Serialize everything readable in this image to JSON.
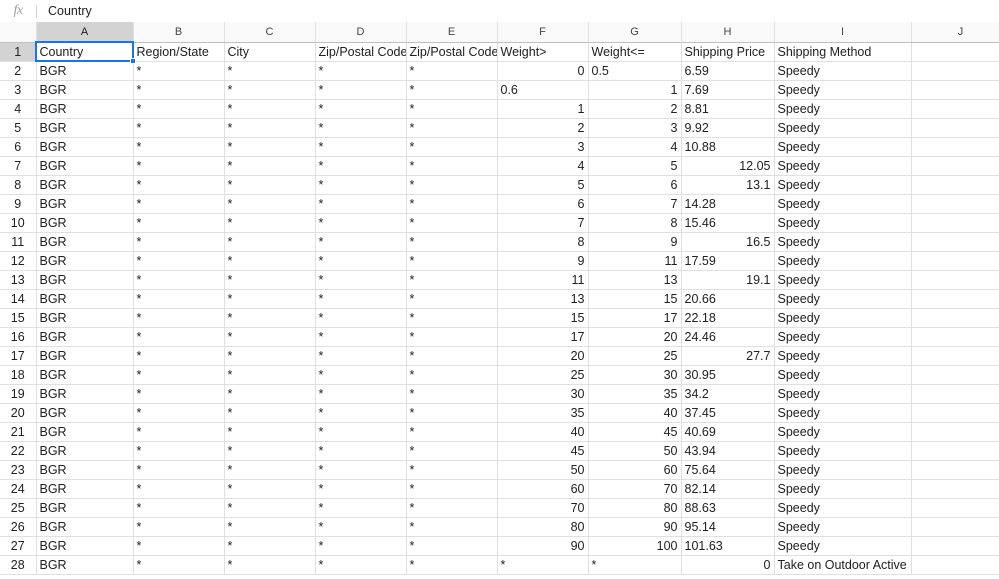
{
  "formula_bar": {
    "fx_label": "fx",
    "value": "Country"
  },
  "selection": {
    "cell": "A1",
    "accent_color": "#1a73e8"
  },
  "grid": {
    "column_letters": [
      "A",
      "B",
      "C",
      "D",
      "E",
      "F",
      "G",
      "H",
      "I",
      "J"
    ],
    "active_column": "A",
    "row_numbers": [
      1,
      2,
      3,
      4,
      5,
      6,
      7,
      8,
      9,
      10,
      11,
      12,
      13,
      14,
      15,
      16,
      17,
      18,
      19,
      20,
      21,
      22,
      23,
      24,
      25,
      26,
      27,
      28
    ],
    "headers": {
      "A": "Country",
      "B": "Region/State",
      "C": "City",
      "D": "Zip/Postal Code",
      "E": "Zip/Postal Code",
      "F": "Weight>",
      "G": "Weight<=",
      "H": "Shipping Price",
      "I": "Shipping Method",
      "J": ""
    },
    "rows": [
      {
        "n": 1,
        "A": "Country",
        "Aa": "left",
        "B": "Region/State",
        "Ba": "left",
        "C": "City",
        "Ca": "left",
        "D": "Zip/Postal Code",
        "Da": "left",
        "E": "Zip/Postal Code",
        "Ea": "left",
        "F": "Weight>",
        "Fa": "left",
        "G": "Weight<=",
        "Ga": "left",
        "H": "Shipping Price",
        "Ha": "left",
        "I": "Shipping Method",
        "Ia": "left",
        "J": ""
      },
      {
        "n": 2,
        "A": "BGR",
        "Aa": "left",
        "B": "*",
        "Ba": "left",
        "C": "*",
        "Ca": "left",
        "D": "*",
        "Da": "left",
        "E": "*",
        "Ea": "left",
        "F": "0",
        "Fa": "right",
        "G": "0.5",
        "Ga": "left",
        "H": "6.59",
        "Ha": "left",
        "I": "Speedy",
        "Ia": "left",
        "J": ""
      },
      {
        "n": 3,
        "A": "BGR",
        "Aa": "left",
        "B": "*",
        "Ba": "left",
        "C": "*",
        "Ca": "left",
        "D": "*",
        "Da": "left",
        "E": "*",
        "Ea": "left",
        "F": "0.6",
        "Fa": "left",
        "G": "1",
        "Ga": "right",
        "H": "7.69",
        "Ha": "left",
        "I": "Speedy",
        "Ia": "left",
        "J": ""
      },
      {
        "n": 4,
        "A": "BGR",
        "Aa": "left",
        "B": "*",
        "Ba": "left",
        "C": "*",
        "Ca": "left",
        "D": "*",
        "Da": "left",
        "E": "*",
        "Ea": "left",
        "F": "1",
        "Fa": "right",
        "G": "2",
        "Ga": "right",
        "H": "8.81",
        "Ha": "left",
        "I": "Speedy",
        "Ia": "left",
        "J": ""
      },
      {
        "n": 5,
        "A": "BGR",
        "Aa": "left",
        "B": "*",
        "Ba": "left",
        "C": "*",
        "Ca": "left",
        "D": "*",
        "Da": "left",
        "E": "*",
        "Ea": "left",
        "F": "2",
        "Fa": "right",
        "G": "3",
        "Ga": "right",
        "H": "9.92",
        "Ha": "left",
        "I": "Speedy",
        "Ia": "left",
        "J": ""
      },
      {
        "n": 6,
        "A": "BGR",
        "Aa": "left",
        "B": "*",
        "Ba": "left",
        "C": "*",
        "Ca": "left",
        "D": "*",
        "Da": "left",
        "E": "*",
        "Ea": "left",
        "F": "3",
        "Fa": "right",
        "G": "4",
        "Ga": "right",
        "H": "10.88",
        "Ha": "left",
        "I": "Speedy",
        "Ia": "left",
        "J": ""
      },
      {
        "n": 7,
        "A": "BGR",
        "Aa": "left",
        "B": "*",
        "Ba": "left",
        "C": "*",
        "Ca": "left",
        "D": "*",
        "Da": "left",
        "E": "*",
        "Ea": "left",
        "F": "4",
        "Fa": "right",
        "G": "5",
        "Ga": "right",
        "H": "12.05",
        "Ha": "right",
        "I": "Speedy",
        "Ia": "left",
        "J": ""
      },
      {
        "n": 8,
        "A": "BGR",
        "Aa": "left",
        "B": "*",
        "Ba": "left",
        "C": "*",
        "Ca": "left",
        "D": "*",
        "Da": "left",
        "E": "*",
        "Ea": "left",
        "F": "5",
        "Fa": "right",
        "G": "6",
        "Ga": "right",
        "H": "13.1",
        "Ha": "right",
        "I": "Speedy",
        "Ia": "left",
        "J": ""
      },
      {
        "n": 9,
        "A": "BGR",
        "Aa": "left",
        "B": "*",
        "Ba": "left",
        "C": "*",
        "Ca": "left",
        "D": "*",
        "Da": "left",
        "E": "*",
        "Ea": "left",
        "F": "6",
        "Fa": "right",
        "G": "7",
        "Ga": "right",
        "H": "14.28",
        "Ha": "left",
        "I": "Speedy",
        "Ia": "left",
        "J": ""
      },
      {
        "n": 10,
        "A": "BGR",
        "Aa": "left",
        "B": "*",
        "Ba": "left",
        "C": "*",
        "Ca": "left",
        "D": "*",
        "Da": "left",
        "E": "*",
        "Ea": "left",
        "F": "7",
        "Fa": "right",
        "G": "8",
        "Ga": "right",
        "H": "15.46",
        "Ha": "left",
        "I": "Speedy",
        "Ia": "left",
        "J": ""
      },
      {
        "n": 11,
        "A": "BGR",
        "Aa": "left",
        "B": "*",
        "Ba": "left",
        "C": "*",
        "Ca": "left",
        "D": "*",
        "Da": "left",
        "E": "*",
        "Ea": "left",
        "F": "8",
        "Fa": "right",
        "G": "9",
        "Ga": "right",
        "H": "16.5",
        "Ha": "right",
        "I": "Speedy",
        "Ia": "left",
        "J": ""
      },
      {
        "n": 12,
        "A": "BGR",
        "Aa": "left",
        "B": "*",
        "Ba": "left",
        "C": "*",
        "Ca": "left",
        "D": "*",
        "Da": "left",
        "E": "*",
        "Ea": "left",
        "F": "9",
        "Fa": "right",
        "G": "11",
        "Ga": "right",
        "H": "17.59",
        "Ha": "left",
        "I": "Speedy",
        "Ia": "left",
        "J": ""
      },
      {
        "n": 13,
        "A": "BGR",
        "Aa": "left",
        "B": "*",
        "Ba": "left",
        "C": "*",
        "Ca": "left",
        "D": "*",
        "Da": "left",
        "E": "*",
        "Ea": "left",
        "F": "11",
        "Fa": "right",
        "G": "13",
        "Ga": "right",
        "H": "19.1",
        "Ha": "right",
        "I": "Speedy",
        "Ia": "left",
        "J": ""
      },
      {
        "n": 14,
        "A": "BGR",
        "Aa": "left",
        "B": "*",
        "Ba": "left",
        "C": "*",
        "Ca": "left",
        "D": "*",
        "Da": "left",
        "E": "*",
        "Ea": "left",
        "F": "13",
        "Fa": "right",
        "G": "15",
        "Ga": "right",
        "H": "20.66",
        "Ha": "left",
        "I": "Speedy",
        "Ia": "left",
        "J": ""
      },
      {
        "n": 15,
        "A": "BGR",
        "Aa": "left",
        "B": "*",
        "Ba": "left",
        "C": "*",
        "Ca": "left",
        "D": "*",
        "Da": "left",
        "E": "*",
        "Ea": "left",
        "F": "15",
        "Fa": "right",
        "G": "17",
        "Ga": "right",
        "H": "22.18",
        "Ha": "left",
        "I": "Speedy",
        "Ia": "left",
        "J": ""
      },
      {
        "n": 16,
        "A": "BGR",
        "Aa": "left",
        "B": "*",
        "Ba": "left",
        "C": "*",
        "Ca": "left",
        "D": "*",
        "Da": "left",
        "E": "*",
        "Ea": "left",
        "F": "17",
        "Fa": "right",
        "G": "20",
        "Ga": "right",
        "H": "24.46",
        "Ha": "left",
        "I": "Speedy",
        "Ia": "left",
        "J": ""
      },
      {
        "n": 17,
        "A": "BGR",
        "Aa": "left",
        "B": "*",
        "Ba": "left",
        "C": "*",
        "Ca": "left",
        "D": "*",
        "Da": "left",
        "E": "*",
        "Ea": "left",
        "F": "20",
        "Fa": "right",
        "G": "25",
        "Ga": "right",
        "H": "27.7",
        "Ha": "right",
        "I": "Speedy",
        "Ia": "left",
        "J": ""
      },
      {
        "n": 18,
        "A": "BGR",
        "Aa": "left",
        "B": "*",
        "Ba": "left",
        "C": "*",
        "Ca": "left",
        "D": "*",
        "Da": "left",
        "E": "*",
        "Ea": "left",
        "F": "25",
        "Fa": "right",
        "G": "30",
        "Ga": "right",
        "H": "30.95",
        "Ha": "left",
        "I": "Speedy",
        "Ia": "left",
        "J": ""
      },
      {
        "n": 19,
        "A": "BGR",
        "Aa": "left",
        "B": "*",
        "Ba": "left",
        "C": "*",
        "Ca": "left",
        "D": "*",
        "Da": "left",
        "E": "*",
        "Ea": "left",
        "F": "30",
        "Fa": "right",
        "G": "35",
        "Ga": "right",
        "H": "34.2",
        "Ha": "left",
        "I": "Speedy",
        "Ia": "left",
        "J": ""
      },
      {
        "n": 20,
        "A": "BGR",
        "Aa": "left",
        "B": "*",
        "Ba": "left",
        "C": "*",
        "Ca": "left",
        "D": "*",
        "Da": "left",
        "E": "*",
        "Ea": "left",
        "F": "35",
        "Fa": "right",
        "G": "40",
        "Ga": "right",
        "H": "37.45",
        "Ha": "left",
        "I": "Speedy",
        "Ia": "left",
        "J": ""
      },
      {
        "n": 21,
        "A": "BGR",
        "Aa": "left",
        "B": "*",
        "Ba": "left",
        "C": "*",
        "Ca": "left",
        "D": "*",
        "Da": "left",
        "E": "*",
        "Ea": "left",
        "F": "40",
        "Fa": "right",
        "G": "45",
        "Ga": "right",
        "H": "40.69",
        "Ha": "left",
        "I": "Speedy",
        "Ia": "left",
        "J": ""
      },
      {
        "n": 22,
        "A": "BGR",
        "Aa": "left",
        "B": "*",
        "Ba": "left",
        "C": "*",
        "Ca": "left",
        "D": "*",
        "Da": "left",
        "E": "*",
        "Ea": "left",
        "F": "45",
        "Fa": "right",
        "G": "50",
        "Ga": "right",
        "H": "43.94",
        "Ha": "left",
        "I": "Speedy",
        "Ia": "left",
        "J": ""
      },
      {
        "n": 23,
        "A": "BGR",
        "Aa": "left",
        "B": "*",
        "Ba": "left",
        "C": "*",
        "Ca": "left",
        "D": "*",
        "Da": "left",
        "E": "*",
        "Ea": "left",
        "F": "50",
        "Fa": "right",
        "G": "60",
        "Ga": "right",
        "H": "75.64",
        "Ha": "left",
        "I": "Speedy",
        "Ia": "left",
        "J": ""
      },
      {
        "n": 24,
        "A": "BGR",
        "Aa": "left",
        "B": "*",
        "Ba": "left",
        "C": "*",
        "Ca": "left",
        "D": "*",
        "Da": "left",
        "E": "*",
        "Ea": "left",
        "F": "60",
        "Fa": "right",
        "G": "70",
        "Ga": "right",
        "H": "82.14",
        "Ha": "left",
        "I": "Speedy",
        "Ia": "left",
        "J": ""
      },
      {
        "n": 25,
        "A": "BGR",
        "Aa": "left",
        "B": "*",
        "Ba": "left",
        "C": "*",
        "Ca": "left",
        "D": "*",
        "Da": "left",
        "E": "*",
        "Ea": "left",
        "F": "70",
        "Fa": "right",
        "G": "80",
        "Ga": "right",
        "H": "88.63",
        "Ha": "left",
        "I": "Speedy",
        "Ia": "left",
        "J": ""
      },
      {
        "n": 26,
        "A": "BGR",
        "Aa": "left",
        "B": "*",
        "Ba": "left",
        "C": "*",
        "Ca": "left",
        "D": "*",
        "Da": "left",
        "E": "*",
        "Ea": "left",
        "F": "80",
        "Fa": "right",
        "G": "90",
        "Ga": "right",
        "H": "95.14",
        "Ha": "left",
        "I": "Speedy",
        "Ia": "left",
        "J": ""
      },
      {
        "n": 27,
        "A": "BGR",
        "Aa": "left",
        "B": "*",
        "Ba": "left",
        "C": "*",
        "Ca": "left",
        "D": "*",
        "Da": "left",
        "E": "*",
        "Ea": "left",
        "F": "90",
        "Fa": "right",
        "G": "100",
        "Ga": "right",
        "H": "101.63",
        "Ha": "left",
        "I": "Speedy",
        "Ia": "left",
        "J": ""
      },
      {
        "n": 28,
        "A": "BGR",
        "Aa": "left",
        "B": "*",
        "Ba": "left",
        "C": "*",
        "Ca": "left",
        "D": "*",
        "Da": "left",
        "E": "*",
        "Ea": "left",
        "F": "*",
        "Fa": "left",
        "G": "*",
        "Ga": "left",
        "H": "0",
        "Ha": "right",
        "I": "Take on Outdoor Active Office",
        "Ia": "left",
        "J": ""
      }
    ]
  }
}
